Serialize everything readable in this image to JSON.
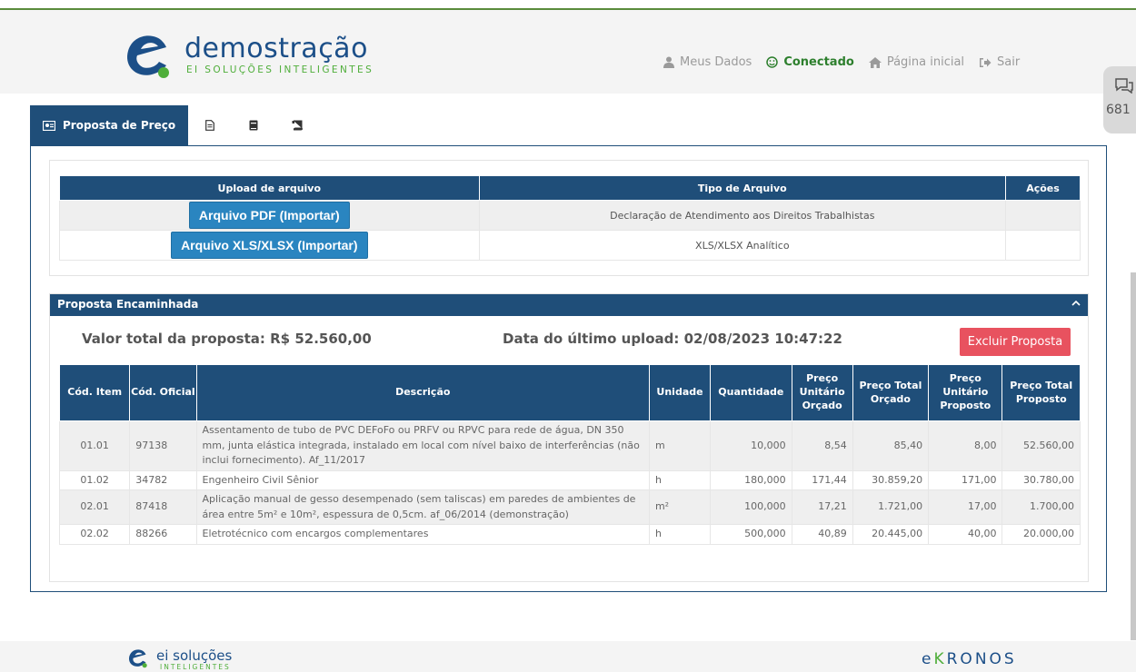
{
  "brand": {
    "name": "demostração",
    "tagline": "EI SOLUÇÕES INTELIGENTES",
    "primary_color": "#1f4e79",
    "accent_color": "#4fae3a"
  },
  "topnav": {
    "my_data": "Meus Dados",
    "connected": "Conectado",
    "home": "Página inicial",
    "logout": "Sair"
  },
  "chat": {
    "count": "681",
    "icon": "chat-icon"
  },
  "tabs": [
    {
      "label": "Proposta de Preço",
      "icon": "id-card-icon",
      "active": true
    },
    {
      "label": "",
      "icon": "document-icon"
    },
    {
      "label": "",
      "icon": "book-icon"
    },
    {
      "label": "",
      "icon": "scroll-icon"
    }
  ],
  "upload": {
    "headers": [
      "Upload de arquivo",
      "Tipo de Arquivo",
      "Ações"
    ],
    "rows": [
      {
        "button": "Arquivo PDF (Importar)",
        "type": "Declaração de Atendimento aos Direitos Trabalhistas",
        "actions": ""
      },
      {
        "button": "Arquivo XLS/XLSX (Importar)",
        "type": "XLS/XLSX Analítico",
        "actions": ""
      }
    ]
  },
  "proposal": {
    "section_title": "Proposta Encaminhada",
    "total_label": "Valor total da proposta: R$ 52.560,00",
    "date_label": "Data do último upload: 02/08/2023 10:47:22",
    "delete_button": "Excluir Proposta",
    "delete_color": "#e8525f",
    "columns": [
      "Cód. Item",
      "Cód. Oficial",
      "Descrição",
      "Unidade",
      "Quantidade",
      "Preço Unitário Orçado",
      "Preço Total Orçado",
      "Preço Unitário Proposto",
      "Preço Total Proposto"
    ],
    "rows": [
      [
        "01.01",
        "97138",
        "Assentamento de tubo de PVC DEFoFo ou PRFV ou RPVC para rede de água, DN 350 mm, junta elástica integrada, instalado em local com nível baixo de interferências (não inclui fornecimento). Af_11/2017",
        "m",
        "10,000",
        "8,54",
        "85,40",
        "8,00",
        "52.560,00"
      ],
      [
        "01.02",
        "34782",
        "Engenheiro Civil Sênior",
        "h",
        "180,000",
        "171,44",
        "30.859,20",
        "171,00",
        "30.780,00"
      ],
      [
        "02.01",
        "87418",
        "Aplicação manual de gesso desempenado (sem taliscas) em paredes de ambientes de área entre 5m² e 10m², espessura de 0,5cm. af_06/2014 (demonstração)",
        "m²",
        "100,000",
        "17,21",
        "1.721,00",
        "17,00",
        "1.700,00"
      ],
      [
        "02.02",
        "88266",
        "Eletrotécnico com encargos complementares",
        "h",
        "500,000",
        "40,89",
        "20.445,00",
        "40,00",
        "20.000,00"
      ]
    ]
  },
  "footer": {
    "left_brand": "ei soluções",
    "left_sub": "INTELIGENTES",
    "right_brand_prefix": "e",
    "right_brand_k": "K",
    "right_brand_suffix": "RONOS"
  }
}
